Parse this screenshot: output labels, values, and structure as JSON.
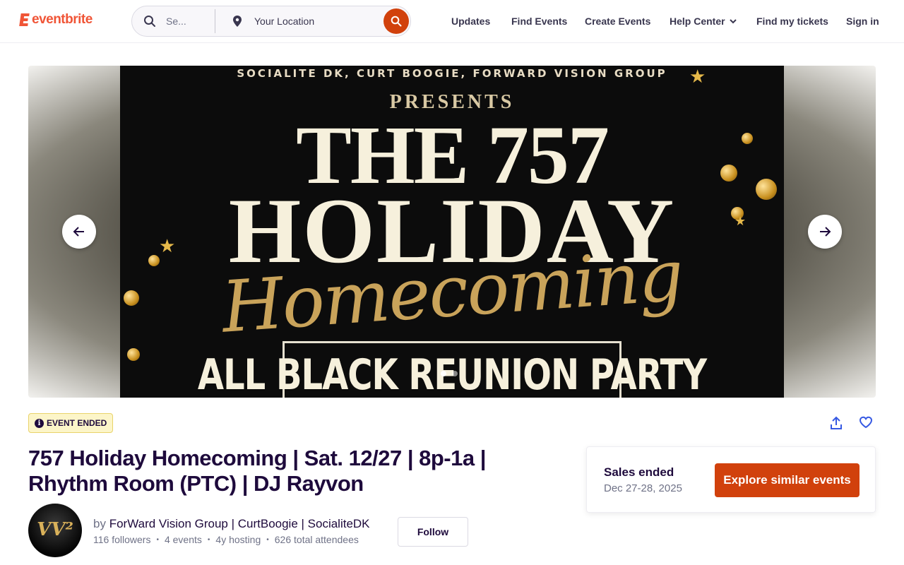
{
  "header": {
    "logo_text": "eventbrite",
    "search_placeholder": "Se...",
    "location_placeholder": "Your Location",
    "nav": {
      "updates": "Updates",
      "find_events": "Find Events",
      "create_events": "Create Events",
      "help_center": "Help Center",
      "find_tickets": "Find my tickets",
      "sign_in": "Sign in"
    }
  },
  "hero": {
    "flyer_presenters": "SOCIALITE DK, CURT BOOGIE, FORWARD VISION GROUP",
    "flyer_presents": "PRESENTS",
    "flyer_line1": "THE 757",
    "flyer_line2": "HOLIDAY",
    "flyer_line3": "Homecoming",
    "flyer_line4": "ALL BLACK REUNION PARTY",
    "slide_count": 2,
    "active_slide": 1
  },
  "event": {
    "status_badge": "EVENT ENDED",
    "title": "757 Holiday Homecoming | Sat. 12/27 | 8p-1a | Rhythm Room (PTC) | DJ Rayvon"
  },
  "organizer": {
    "by": "by",
    "name": "ForWard Vision Group | CurtBoogie | SocialiteDK",
    "followers": "116 followers",
    "events": "4 events",
    "hosting": "4y hosting",
    "attendees": "626 total attendees",
    "follow_label": "Follow",
    "avatar_text": "VV²"
  },
  "sales": {
    "status": "Sales ended",
    "dates": "Dec 27-28, 2025",
    "cta": "Explore similar events"
  },
  "colors": {
    "brand": "#f05537",
    "cta": "#d1410c",
    "text_primary": "#1e0a3c",
    "badge_bg": "#fcf5c9"
  }
}
